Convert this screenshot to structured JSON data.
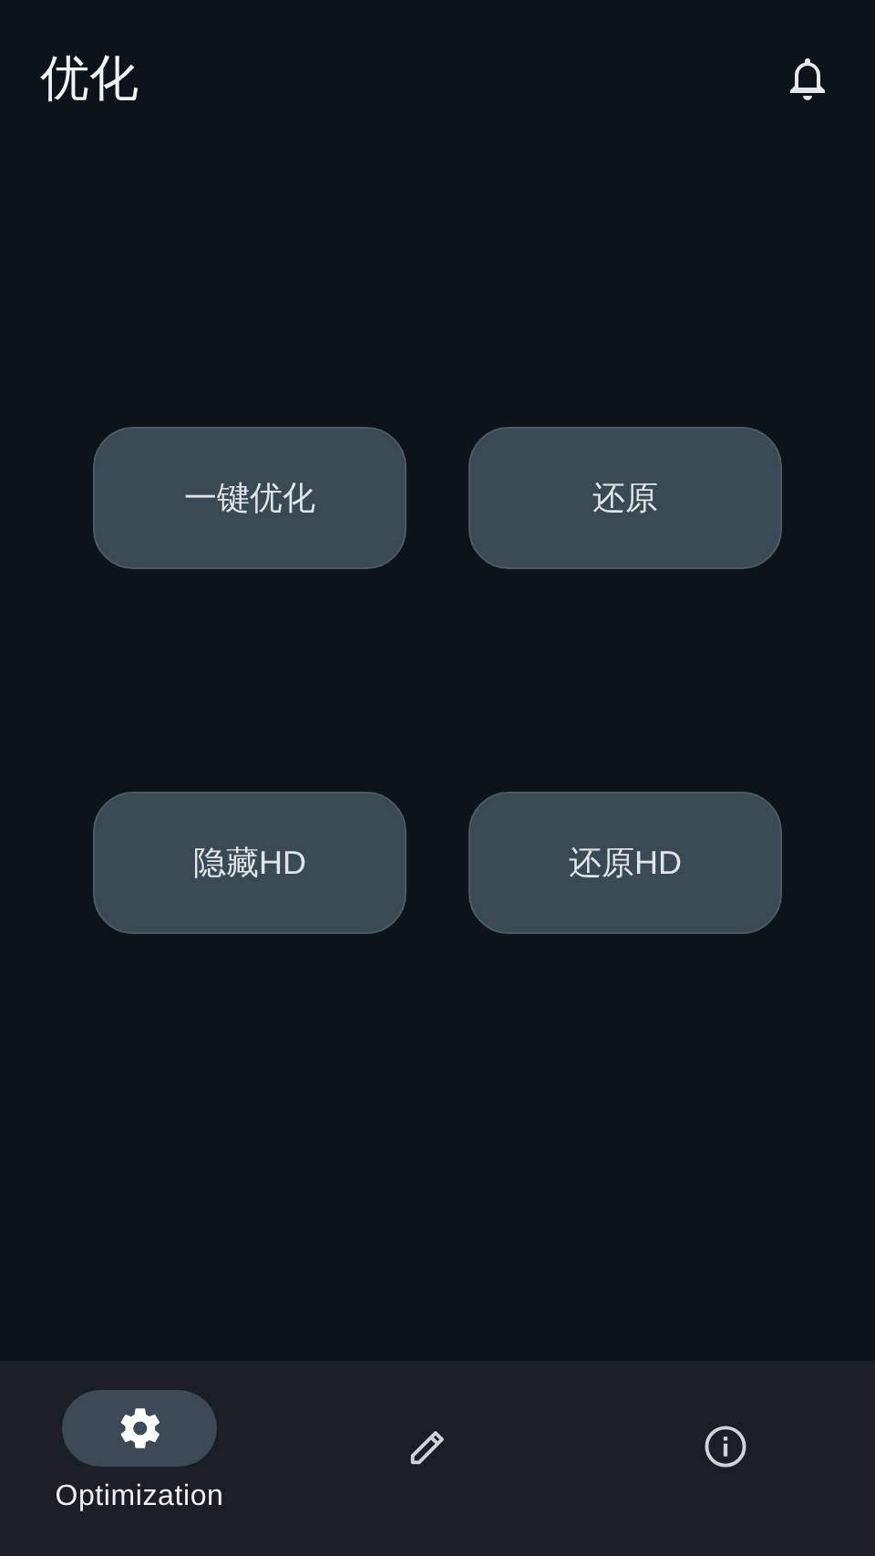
{
  "app_bar": {
    "title": "优化"
  },
  "actions": [
    {
      "label": "一键优化"
    },
    {
      "label": "还原"
    },
    {
      "label": "隐藏HD"
    },
    {
      "label": "还原HD"
    }
  ],
  "nav": [
    {
      "kind": "gear",
      "label": "Optimization",
      "selected": true
    },
    {
      "kind": "pencil",
      "selected": false
    },
    {
      "kind": "info",
      "selected": false
    }
  ]
}
